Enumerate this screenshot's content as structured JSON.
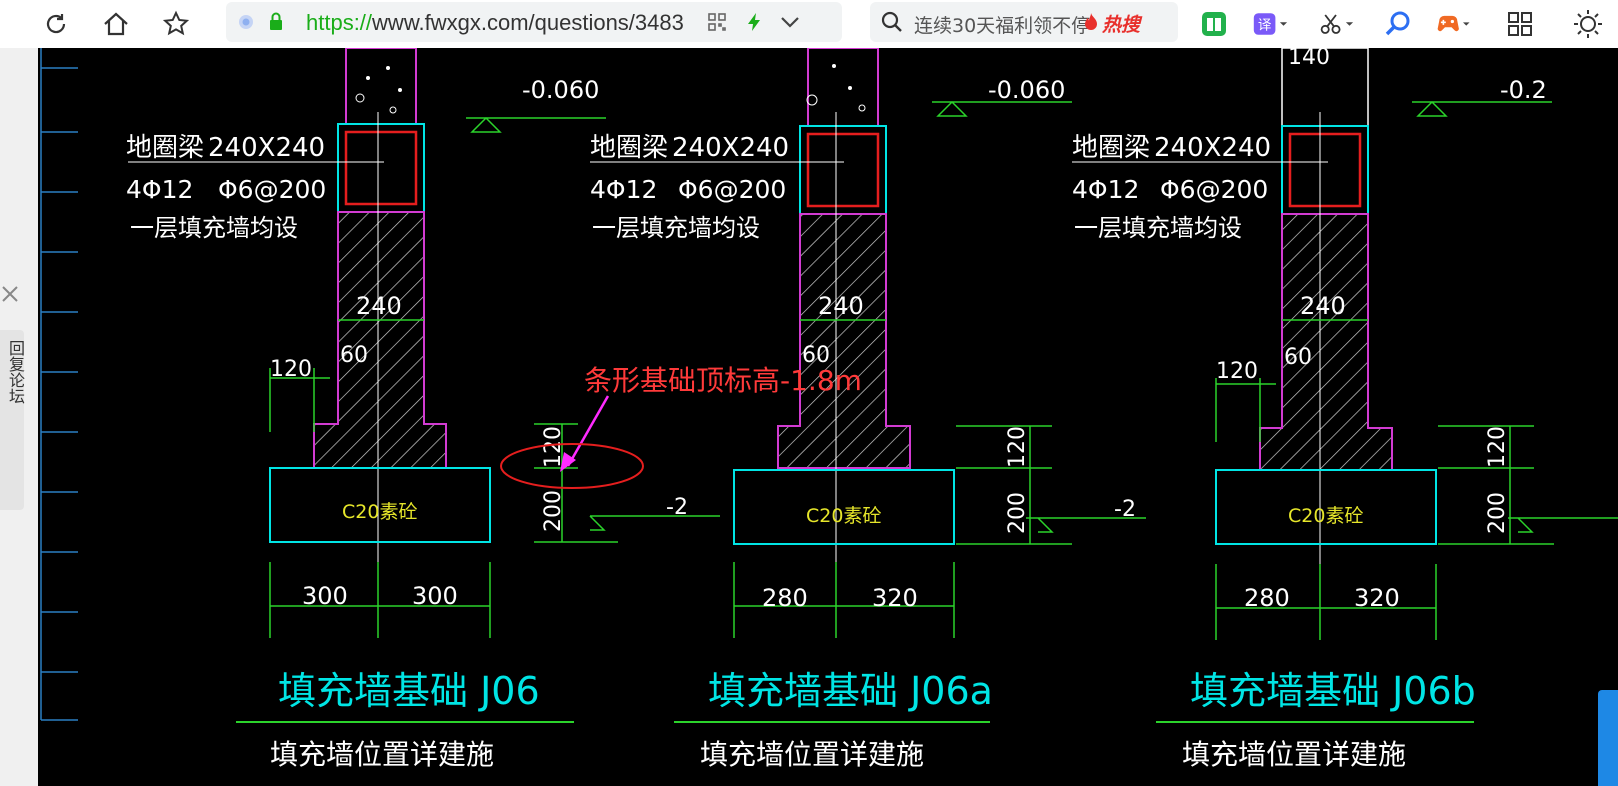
{
  "browser": {
    "url_scheme": "https://",
    "url_rest": "www.fwxgx.com/questions/3483",
    "search_placeholder": "连续30天福利领不停",
    "hot_search_label": "热搜"
  },
  "left_panel": {
    "tab_label": "回复论坛"
  },
  "drawing": {
    "annotation_label": "条形基础顶标高-1.8m",
    "details": [
      {
        "beam_label": "地圈梁",
        "beam_size": "240X240",
        "rebar_main": "4Φ12",
        "rebar_stirrup": "Φ6@200",
        "note": "一层填充墙均设",
        "elevation": "-0.060",
        "wall_width": "240",
        "offset_60": "60",
        "step_120": "120",
        "concrete_label": "C20素砼",
        "dim_left": "300",
        "dim_right": "300",
        "height_top": "120",
        "height_bottom": "200",
        "bottom_elev": "-2",
        "title": "填充墙基础 J06",
        "subtitle": "填充墙位置详建施"
      },
      {
        "beam_label": "地圈梁",
        "beam_size": "240X240",
        "rebar_main": "4Φ12",
        "rebar_stirrup": "Φ6@200",
        "note": "一层填充墙均设",
        "elevation": "-0.060",
        "wall_width": "240",
        "offset_60": "60",
        "step_120": "120",
        "concrete_label": "C20素砼",
        "dim_left": "280",
        "dim_right": "320",
        "height_top": "120",
        "height_bottom": "200",
        "bottom_elev": "-2",
        "title": "填充墙基础 J06a",
        "subtitle": "填充墙位置详建施"
      },
      {
        "beam_label": "地圈梁",
        "beam_size": "240X240",
        "rebar_main": "4Φ12",
        "rebar_stirrup": "Φ6@200",
        "note": "一层填充墙均设",
        "elevation": "-0.2",
        "wall_width": "240",
        "offset_60": "60",
        "step_120": "120",
        "concrete_label": "C20素砼",
        "dim_left": "280",
        "dim_right": "320",
        "height_top": "120",
        "height_bottom": "200",
        "top_dim": "140",
        "title": "填充墙基础 J06b",
        "subtitle": "填充墙位置详建施"
      }
    ],
    "colors": {
      "cyan": "#00e5e5",
      "green": "#2bd32b",
      "magenta": "#d23bd2",
      "red": "#e51e1e",
      "white": "#ffffff",
      "yellow": "#e6e62a",
      "annotation": "#ff3a3a",
      "arrow": "#ff2bff"
    }
  }
}
